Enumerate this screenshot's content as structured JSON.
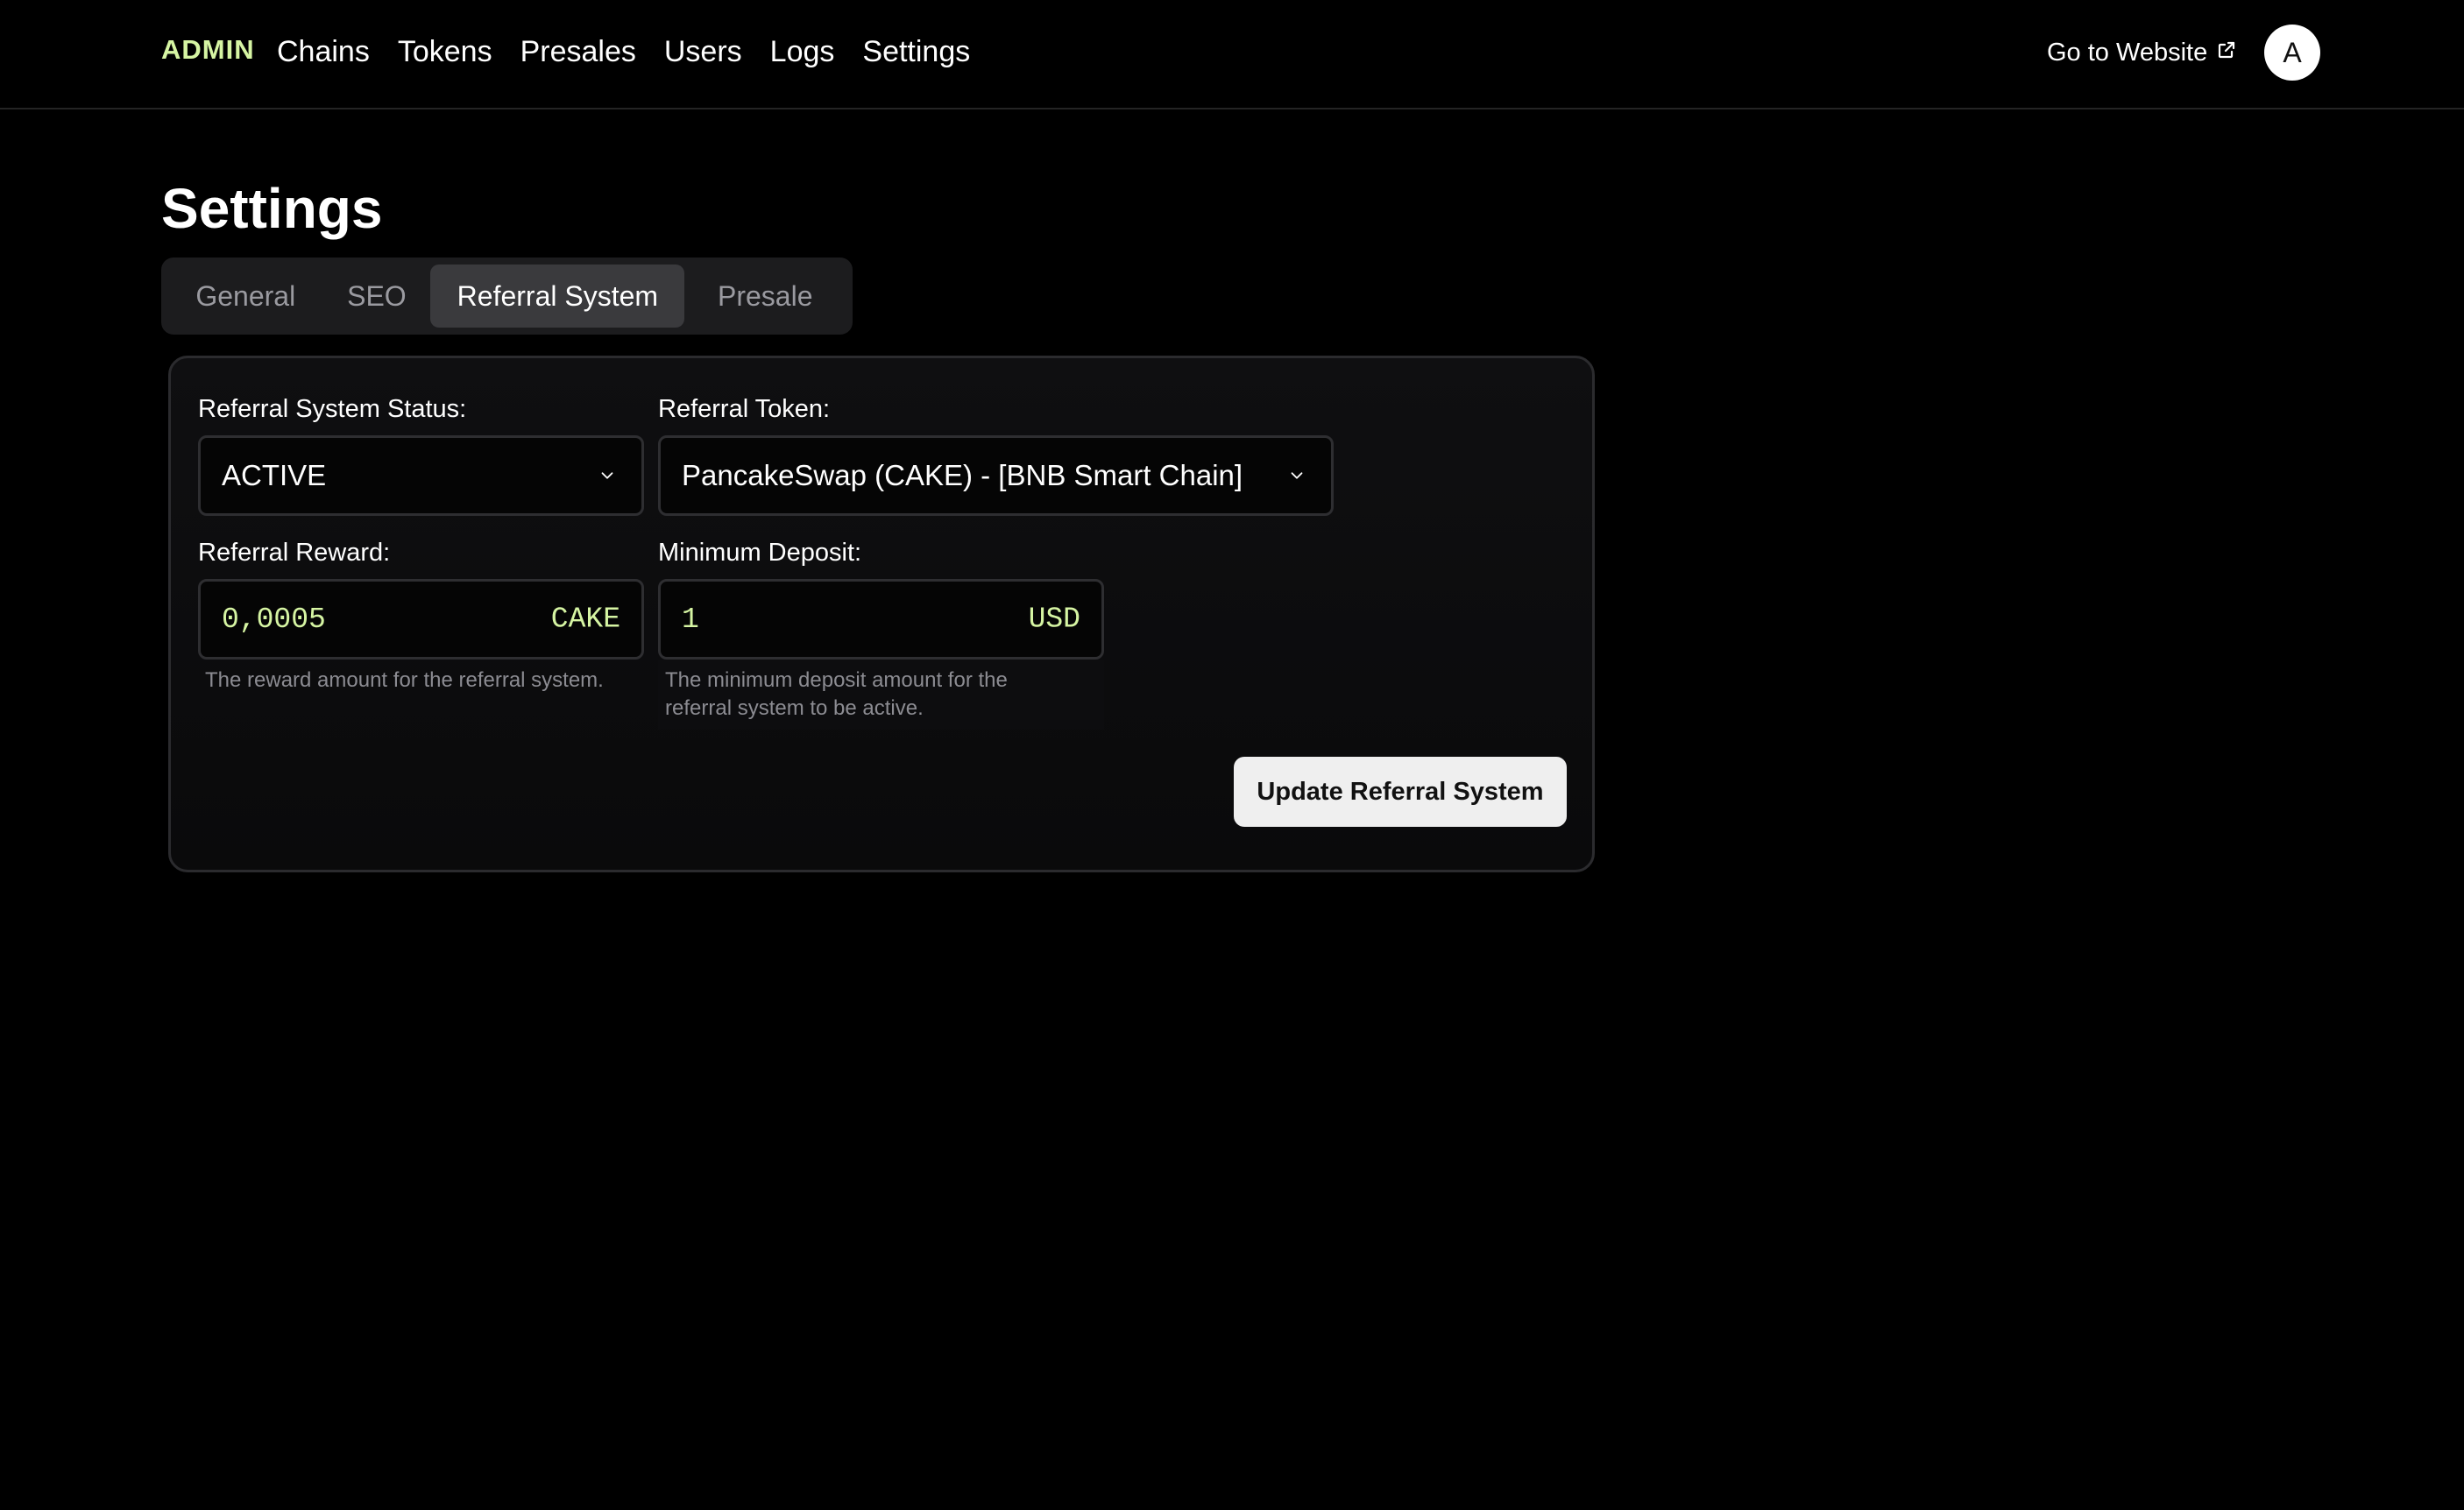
{
  "nav": {
    "brand": "ADMIN",
    "links": [
      "Chains",
      "Tokens",
      "Presales",
      "Users",
      "Logs",
      "Settings"
    ],
    "go_to_website": "Go to Website",
    "avatar_initial": "A"
  },
  "page": {
    "title": "Settings",
    "tabs": [
      {
        "label": "General",
        "active": false
      },
      {
        "label": "SEO",
        "active": false
      },
      {
        "label": "Referral System",
        "active": true
      },
      {
        "label": "Presale",
        "active": false
      }
    ]
  },
  "referral_form": {
    "status": {
      "label": "Referral System Status:",
      "value": "ACTIVE"
    },
    "token": {
      "label": "Referral Token:",
      "value": "PancakeSwap (CAKE) - [BNB Smart Chain]"
    },
    "reward": {
      "label": "Referral Reward:",
      "value": "0,0005",
      "unit": "CAKE",
      "help": "The reward amount for the referral system."
    },
    "min_deposit": {
      "label": "Minimum Deposit:",
      "value": "1",
      "unit": "USD",
      "help": "The minimum deposit amount for the referral system to be active."
    },
    "submit_label": "Update Referral System"
  },
  "colors": {
    "accent": "#d6f5a3",
    "background": "#000000",
    "card_border": "#2b2b2e"
  }
}
